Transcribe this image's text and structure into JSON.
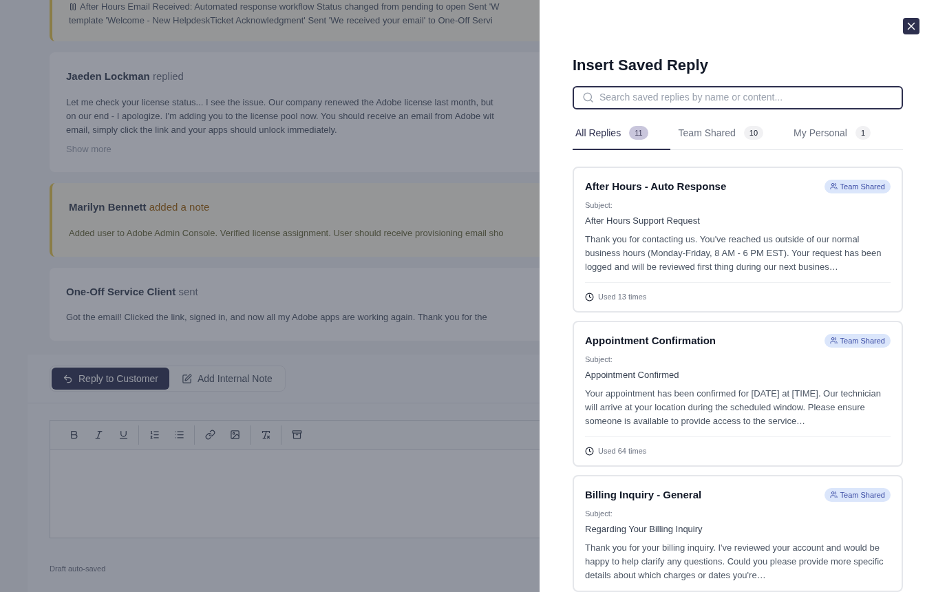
{
  "timeline": [
    {
      "kind": "system",
      "lines": [
        "After Hours Email Received: Automated response workflow Status changed from pending to open Sent 'W",
        "template 'Welcome - New HelpdeskTicket Acknowledgment' Sent 'We received your email' to One-Off Servi"
      ]
    },
    {
      "kind": "reply",
      "author": "Jaeden Lockman",
      "action": "replied",
      "lines": [
        "Let me check your license status... I see the issue. Our company renewed the Adobe license last month, but",
        "on our end - I apologize. I'm adding you to the license pool now. You should receive an email from Adobe wit",
        "email, simply click the link and your apps should unlock immediately."
      ],
      "more": "Show more"
    },
    {
      "kind": "note",
      "author": "Marilyn Bennett",
      "action": "added a note",
      "lines": [
        "Added user to Adobe Admin Console. Verified license assignment. User should receive provisioning email sho"
      ]
    },
    {
      "kind": "reply",
      "author": "One-Off Service Client",
      "action": "sent",
      "lines": [
        "Got the email! Clicked the link, signed in, and now all my Adobe apps are working again. Thank you for the"
      ]
    }
  ],
  "composer": {
    "modes": [
      {
        "label": "Reply to Customer",
        "kind": "reply",
        "selected": true
      },
      {
        "label": "Add Internal Note",
        "kind": "note",
        "selected": false
      }
    ],
    "toolbar": [
      [
        {
          "kind": "bold"
        },
        {
          "kind": "italic"
        },
        {
          "kind": "underline"
        }
      ],
      [
        {
          "kind": "ordered-list"
        },
        {
          "kind": "bullet-list"
        }
      ],
      [
        {
          "kind": "link"
        },
        {
          "kind": "image"
        }
      ],
      [
        {
          "kind": "clear-format"
        }
      ],
      [
        {
          "kind": "box"
        }
      ]
    ],
    "status": "Draft auto-saved"
  },
  "dialog": {
    "title": "Insert Saved Reply",
    "search": {
      "placeholder": "Search saved replies by name or content..."
    },
    "tabs": [
      {
        "label": "All Replies",
        "count": "11",
        "selected": true
      },
      {
        "label": "Team Shared",
        "count": "10",
        "selected": false
      },
      {
        "label": "My Personal",
        "count": "1",
        "selected": false
      }
    ],
    "replies": [
      {
        "name": "After Hours - Auto Response",
        "badge": "Team Shared",
        "subject_label": "Subject:",
        "subject": "After Hours Support Request",
        "preview": "Thank you for contacting us. You've reached us outside of our normal business hours (Monday-Friday, 8 AM - 6 PM EST). Your request has been logged and will be reviewed first thing during our next busines…",
        "usage": "Used 13 times"
      },
      {
        "name": "Appointment Confirmation",
        "badge": "Team Shared",
        "subject_label": "Subject:",
        "subject": "Appointment Confirmed",
        "preview": "Your appointment has been confirmed for [DATE] at [TIME]. Our technician will arrive at your location during the scheduled window. Please ensure someone is available to provide access to the service…",
        "usage": "Used 64 times"
      },
      {
        "name": "Billing Inquiry - General",
        "badge": "Team Shared",
        "subject_label": "Subject:",
        "subject": "Regarding Your Billing Inquiry",
        "preview": "Thank you for your billing inquiry. I've reviewed your account and would be happy to help clarify any questions. Could you please provide more specific details about which charges or dates you're…"
      }
    ]
  }
}
